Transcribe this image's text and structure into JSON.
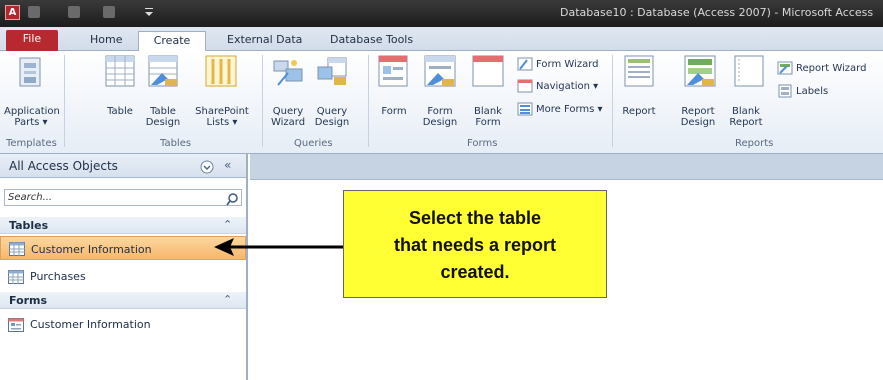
{
  "window": {
    "app_icon_letter": "A",
    "title": "Database10 : Database (Access 2007) - Microsoft Access"
  },
  "tabs": [
    {
      "label": "File"
    },
    {
      "label": "Home"
    },
    {
      "label": "Create"
    },
    {
      "label": "External Data"
    },
    {
      "label": "Database Tools"
    }
  ],
  "ribbon": {
    "groups": {
      "templates": "Templates",
      "tables": "Tables",
      "queries": "Queries",
      "forms": "Forms",
      "reports": "Reports"
    },
    "commands": {
      "application_parts": "Application\nParts ▾",
      "table": "Table",
      "table_design": "Table\nDesign",
      "sharepoint_lists": "SharePoint\nLists ▾",
      "query_wizard": "Query\nWizard",
      "query_design": "Query\nDesign",
      "form": "Form",
      "form_design": "Form\nDesign",
      "blank_form": "Blank\nForm",
      "form_wizard": "Form Wizard",
      "navigation": "Navigation ▾",
      "more_forms": "More Forms ▾",
      "report": "Report",
      "report_design": "Report\nDesign",
      "blank_report": "Blank\nReport",
      "report_wizard": "Report Wizard",
      "labels": "Labels"
    }
  },
  "nav_pane": {
    "title": "All Access Objects",
    "search_placeholder": "Search...",
    "sections": [
      {
        "label": "Tables",
        "items": [
          "Customer Information",
          "Purchases"
        ]
      },
      {
        "label": "Forms",
        "items": [
          "Customer Information"
        ]
      }
    ]
  },
  "callout": {
    "text": "Select the table\nthat needs a report\ncreated."
  },
  "colors": {
    "file_tab": "#b8292f",
    "selected_item": "#f8b76a",
    "callout_bg": "#ffff33"
  }
}
